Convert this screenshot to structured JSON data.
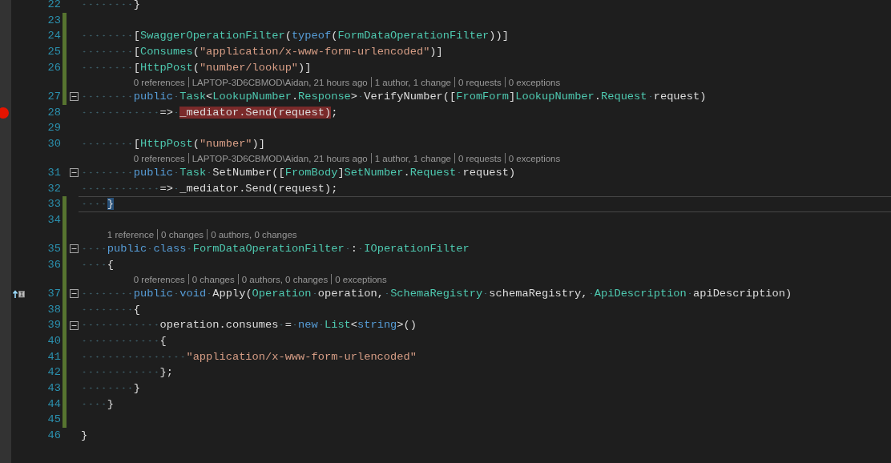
{
  "lines": [
    {
      "number": "22",
      "changed": false,
      "tokens": [
        {
          "text": "        }",
          "kind": "plain"
        }
      ]
    },
    {
      "number": "23",
      "changed": true
    },
    {
      "number": "24",
      "changed": true,
      "tokens": [
        {
          "text": "        [",
          "kind": "plain"
        },
        {
          "text": "SwaggerOperationFilter",
          "kind": "type"
        },
        {
          "text": "(",
          "kind": "plain"
        },
        {
          "text": "typeof",
          "kind": "keyword"
        },
        {
          "text": "(",
          "kind": "plain"
        },
        {
          "text": "FormDataOperationFilter",
          "kind": "type"
        },
        {
          "text": "))]",
          "kind": "plain"
        }
      ]
    },
    {
      "number": "25",
      "changed": true,
      "tokens": [
        {
          "text": "        [",
          "kind": "plain"
        },
        {
          "text": "Consumes",
          "kind": "type"
        },
        {
          "text": "(",
          "kind": "plain"
        },
        {
          "text": "\"application/x-www-form-urlencoded\"",
          "kind": "string"
        },
        {
          "text": ")]",
          "kind": "plain"
        }
      ]
    },
    {
      "number": "26",
      "changed": true,
      "tokens": [
        {
          "text": "        [",
          "kind": "plain"
        },
        {
          "text": "HttpPost",
          "kind": "type"
        },
        {
          "text": "(",
          "kind": "plain"
        },
        {
          "text": "\"number/lookup\"",
          "kind": "string"
        },
        {
          "text": ")]",
          "kind": "plain"
        }
      ]
    },
    {
      "number": "27",
      "changed": true,
      "fold": {
        "expanded": true
      },
      "lens": [
        "0 references",
        "LAPTOP-3D6CBMOD\\Aidan, 21 hours ago",
        "1 author, 1 change",
        "0 requests",
        "0 exceptions"
      ],
      "tokens": [
        {
          "text": "        public ",
          "kind": "keyword"
        },
        {
          "text": "Task",
          "kind": "type"
        },
        {
          "text": "<",
          "kind": "plain"
        },
        {
          "text": "LookupNumber",
          "kind": "type"
        },
        {
          "text": ".",
          "kind": "plain"
        },
        {
          "text": "Response",
          "kind": "type"
        },
        {
          "text": "> VerifyNumber([",
          "kind": "plain"
        },
        {
          "text": "FromForm",
          "kind": "type"
        },
        {
          "text": "]",
          "kind": "plain"
        },
        {
          "text": "LookupNumber",
          "kind": "type"
        },
        {
          "text": ".",
          "kind": "plain"
        },
        {
          "text": "Request",
          "kind": "type"
        },
        {
          "text": " request)",
          "kind": "plain"
        }
      ]
    },
    {
      "number": "28",
      "changed": false,
      "breakpoint": true,
      "tokens": [
        {
          "text": "            => ",
          "kind": "plain"
        },
        {
          "text": "_mediator.Send(request)",
          "kind": "plain",
          "highlight": true
        },
        {
          "text": ";",
          "kind": "plain"
        }
      ]
    },
    {
      "number": "29",
      "changed": false
    },
    {
      "number": "30",
      "changed": false,
      "tokens": [
        {
          "text": "        [",
          "kind": "plain"
        },
        {
          "text": "HttpPost",
          "kind": "type"
        },
        {
          "text": "(",
          "kind": "plain"
        },
        {
          "text": "\"number\"",
          "kind": "string"
        },
        {
          "text": ")]",
          "kind": "plain"
        }
      ]
    },
    {
      "number": "31",
      "changed": false,
      "fold": {
        "expanded": true
      },
      "lens": [
        "0 references",
        "LAPTOP-3D6CBMOD\\Aidan, 21 hours ago",
        "1 author, 1 change",
        "0 requests",
        "0 exceptions"
      ],
      "tokens": [
        {
          "text": "        public ",
          "kind": "keyword"
        },
        {
          "text": "Task",
          "kind": "type"
        },
        {
          "text": " SetNumber([",
          "kind": "plain"
        },
        {
          "text": "FromBody",
          "kind": "type"
        },
        {
          "text": "]",
          "kind": "plain"
        },
        {
          "text": "SetNumber",
          "kind": "type"
        },
        {
          "text": ".",
          "kind": "plain"
        },
        {
          "text": "Request",
          "kind": "type"
        },
        {
          "text": " request)",
          "kind": "plain"
        }
      ]
    },
    {
      "number": "32",
      "changed": false,
      "tokens": [
        {
          "text": "            => _mediator.Send(request);",
          "kind": "plain"
        }
      ]
    },
    {
      "number": "33",
      "changed": true,
      "current": true,
      "tokens": [
        {
          "text": "    }",
          "kind": "plain",
          "match": true
        }
      ]
    },
    {
      "number": "34",
      "changed": true
    },
    {
      "number": "35",
      "changed": true,
      "fold": {
        "expanded": true
      },
      "lens": [
        "1 reference",
        "0 changes",
        "0 authors, 0 changes"
      ],
      "tokens": [
        {
          "text": "    public class ",
          "kind": "keyword"
        },
        {
          "text": "FormDataOperationFilter",
          "kind": "type"
        },
        {
          "text": " : ",
          "kind": "plain"
        },
        {
          "text": "IOperationFilter",
          "kind": "type"
        }
      ]
    },
    {
      "number": "36",
      "changed": true,
      "tokens": [
        {
          "text": "    {",
          "kind": "plain"
        }
      ]
    },
    {
      "number": "37",
      "changed": true,
      "implements": true,
      "fold": {
        "expanded": true
      },
      "lens": [
        "0 references",
        "0 changes",
        "0 authors, 0 changes",
        "0 exceptions"
      ],
      "tokens": [
        {
          "text": "        public void",
          "kind": "keyword"
        },
        {
          "text": " Apply(",
          "kind": "plain"
        },
        {
          "text": "Operation",
          "kind": "type"
        },
        {
          "text": " operation, ",
          "kind": "plain"
        },
        {
          "text": "SchemaRegistry",
          "kind": "type"
        },
        {
          "text": " schemaRegistry, ",
          "kind": "plain"
        },
        {
          "text": "ApiDescription",
          "kind": "type"
        },
        {
          "text": " apiDescription)",
          "kind": "plain"
        }
      ]
    },
    {
      "number": "38",
      "changed": true,
      "tokens": [
        {
          "text": "        {",
          "kind": "plain"
        }
      ]
    },
    {
      "number": "39",
      "changed": true,
      "fold": {
        "expanded": true
      },
      "tokens": [
        {
          "text": "            operation.consumes = ",
          "kind": "plain"
        },
        {
          "text": "new ",
          "kind": "keyword"
        },
        {
          "text": "List",
          "kind": "type"
        },
        {
          "text": "<",
          "kind": "plain"
        },
        {
          "text": "string",
          "kind": "keyword"
        },
        {
          "text": ">()",
          "kind": "plain"
        }
      ]
    },
    {
      "number": "40",
      "changed": true,
      "tokens": [
        {
          "text": "            {",
          "kind": "plain"
        }
      ]
    },
    {
      "number": "41",
      "changed": true,
      "tokens": [
        {
          "text": "                \"application/x-www-form-urlencoded\"",
          "kind": "string"
        }
      ]
    },
    {
      "number": "42",
      "changed": true,
      "tokens": [
        {
          "text": "            };",
          "kind": "plain"
        }
      ]
    },
    {
      "number": "43",
      "changed": true,
      "tokens": [
        {
          "text": "        }",
          "kind": "plain"
        }
      ]
    },
    {
      "number": "44",
      "changed": true,
      "tokens": [
        {
          "text": "    }",
          "kind": "plain"
        }
      ]
    },
    {
      "number": "45",
      "changed": true
    },
    {
      "number": "46",
      "changed": false,
      "tokens": [
        {
          "text": "}",
          "kind": "plain"
        }
      ]
    }
  ]
}
